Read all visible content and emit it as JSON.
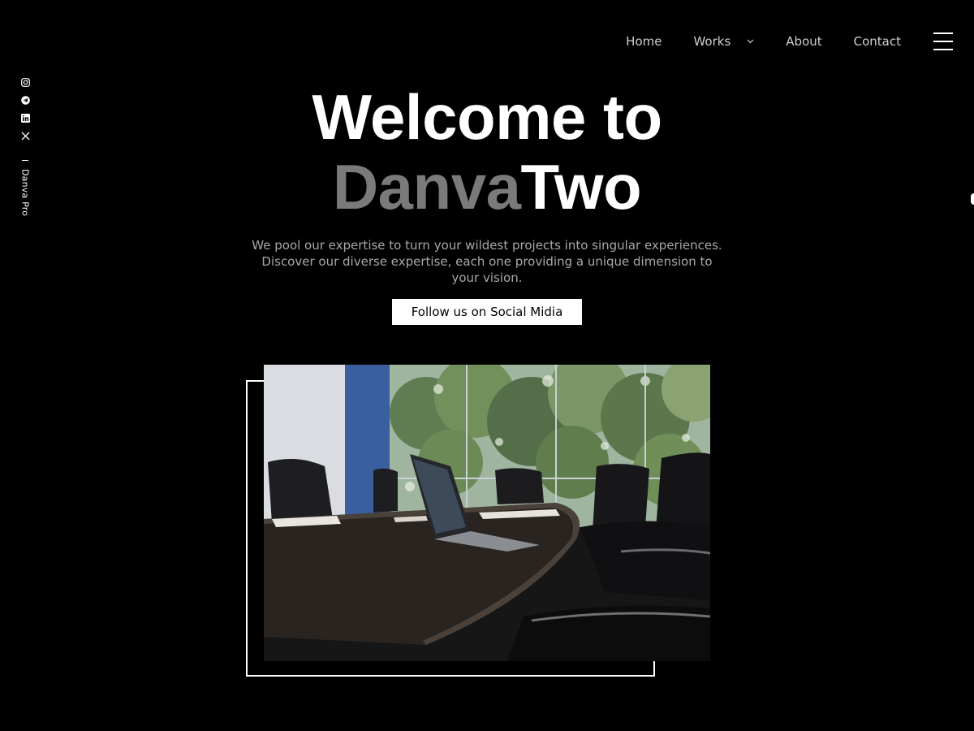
{
  "nav": {
    "items": [
      "Home",
      "Works",
      "About",
      "Contact"
    ],
    "has_dropdown": "Works",
    "menu_icon": "hamburger-menu-icon"
  },
  "social": {
    "icons": [
      "instagram-icon",
      "telegram-icon",
      "linkedin-icon",
      "x-twitter-icon"
    ],
    "brand": "Danva Pro"
  },
  "hero": {
    "line1": "Welcome to",
    "line2_grey": "Danva",
    "line2_white": "Two",
    "description": "We pool our expertise to turn your wildest projects into singular experiences. Discover our diverse expertise, each one providing a unique dimension to your vision.",
    "cta_label": "Follow us on Social Midia"
  },
  "media": {
    "image_subject": "conference-room-photo"
  },
  "colors": {
    "background": "#000000",
    "text": "#ffffff",
    "muted_text": "#a8a8a8",
    "accent_grey": "#7a7a7a"
  }
}
